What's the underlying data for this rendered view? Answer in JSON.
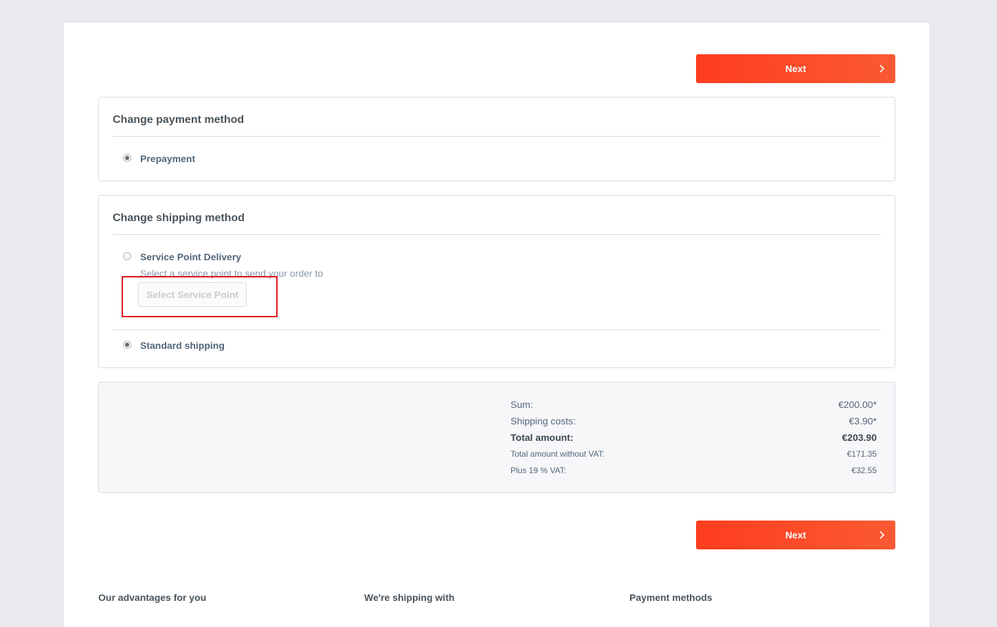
{
  "buttons": {
    "next_label": "Next"
  },
  "payment": {
    "title": "Change payment method",
    "options": [
      {
        "label": "Prepayment",
        "selected": true
      }
    ]
  },
  "shipping": {
    "title": "Change shipping method",
    "options": [
      {
        "label": "Service Point Delivery",
        "selected": false,
        "description": "Select a service point to send your order to",
        "button": "Select Service Point"
      },
      {
        "label": "Standard shipping",
        "selected": true
      }
    ]
  },
  "summary": {
    "rows": [
      {
        "label": "Sum:",
        "value": "€200.00*"
      },
      {
        "label": "Shipping costs:",
        "value": "€3.90*"
      },
      {
        "label": "Total amount:",
        "value": "€203.90"
      },
      {
        "label": "Total amount without VAT:",
        "value": "€171.35"
      },
      {
        "label": "Plus 19 % VAT:",
        "value": "€32.55"
      }
    ]
  },
  "footer": {
    "col1": "Our advantages for you",
    "col2": "We're shipping with",
    "col3": "Payment methods"
  },
  "colors": {
    "accent": "#ff3d1f",
    "highlight": "#e0141e"
  },
  "icons": {
    "next_chevron": "chevron-right-icon"
  }
}
